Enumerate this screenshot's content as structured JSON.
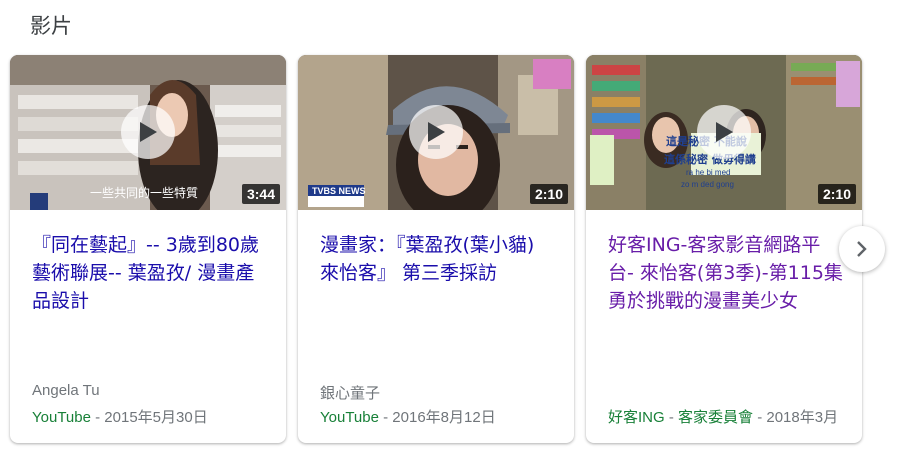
{
  "section": {
    "title": "影片"
  },
  "cards": [
    {
      "title": "『同在藝起』-- 3歲到80歲藝術聯展-- 葉盈孜/ 漫畫產品設計",
      "duration": "3:44",
      "author": "Angela Tu",
      "source": "YouTube",
      "date": "2015年5月30日",
      "subtitle_overlay": "一些共同的一些特質"
    },
    {
      "title": "漫畫家：『葉盈孜(葉小貓) 來怡客』 第三季採訪",
      "duration": "2:10",
      "author": "銀心童子",
      "source": "YouTube",
      "date": "2016年8月12日",
      "logo_overlay": "TVBS NEWS"
    },
    {
      "title": "好客ING-客家影音網路平台- 來怡客(第3季)-第115集勇於挑戰的漫畫美少女",
      "duration": "2:10",
      "author": "",
      "source": "好客ING",
      "channel": "客家委員會",
      "date": "2018年3月",
      "caption_overlay_1": "這是秘密 不能說",
      "caption_overlay_2": "這係秘密 做毋得講",
      "caption_overlay_3": "ra he bi med",
      "caption_overlay_4": "zo m ded gong"
    }
  ],
  "colors": {
    "link": "#1a0dab",
    "visited": "#681da8",
    "source_green": "#188038",
    "meta_grey": "#70757a"
  },
  "icons": {
    "play": "play-icon",
    "next": "chevron-right-icon"
  }
}
